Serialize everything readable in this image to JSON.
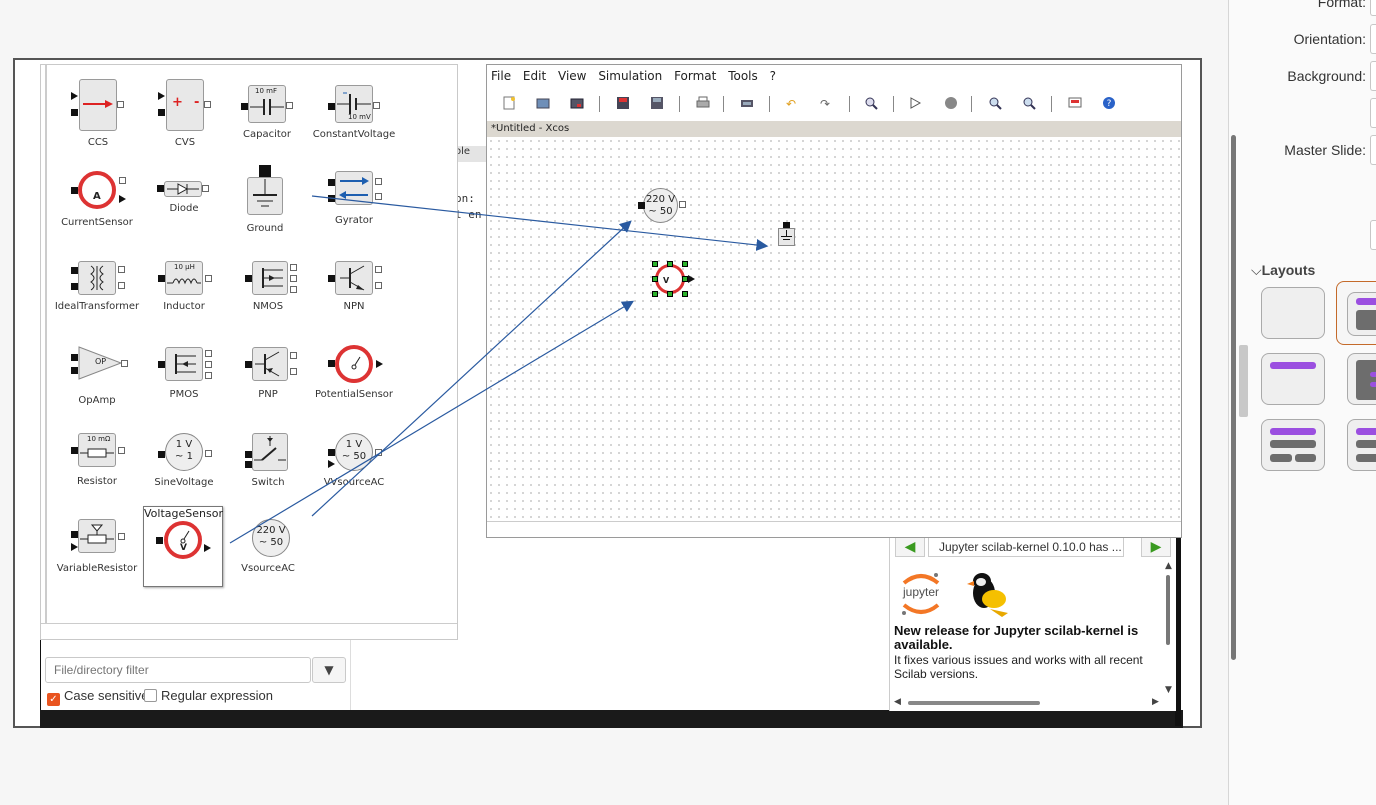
{
  "props_panel": {
    "format_label": "Format:",
    "orientation_label": "Orientation:",
    "background_label": "Background:",
    "master_slide_label": "Master Slide:",
    "layouts_title": "Layouts",
    "layouts_chevron": "⌵",
    "accent_color": "#9b4fe0"
  },
  "xcos": {
    "menu": {
      "file": "File",
      "edit": "Edit",
      "view": "View",
      "simulation": "Simulation",
      "format": "Format",
      "tools": "Tools",
      "help": "?"
    },
    "toolbar_icons": [
      "new-icon",
      "open-icon",
      "open-file-icon",
      "save-icon",
      "save-as-icon",
      "print-icon",
      "export-icon",
      "undo-icon",
      "redo-icon",
      "fit-icon",
      "start-icon",
      "stop-icon",
      "zoom-in-icon",
      "zoom-out-icon",
      "xcos-demos-icon",
      "help-icon"
    ],
    "tab_title": "*Untitled - Xcos",
    "canvas_blocks": {
      "vsource_line1": "220 V",
      "vsource_line2": "~ 50"
    }
  },
  "console_peek": {
    "line1": "ole",
    "line2": "on:",
    "line3": "l en"
  },
  "palette": {
    "blocks": [
      {
        "name": "CCS"
      },
      {
        "name": "CVS"
      },
      {
        "name": "Capacitor",
        "badge": "10 mF"
      },
      {
        "name": "ConstantVoltage",
        "badge": "10 mV"
      },
      {
        "name": "CurrentSensor"
      },
      {
        "name": "Diode"
      },
      {
        "name": "Ground"
      },
      {
        "name": "Gyrator"
      },
      {
        "name": "IdealTransformer"
      },
      {
        "name": "Inductor",
        "badge": "10 μH"
      },
      {
        "name": "NMOS"
      },
      {
        "name": "NPN"
      },
      {
        "name": "OpAmp",
        "badge": "OP"
      },
      {
        "name": "PMOS"
      },
      {
        "name": "PNP"
      },
      {
        "name": "PotentialSensor"
      },
      {
        "name": "Resistor",
        "badge": "10 mΩ"
      },
      {
        "name": "SineVoltage",
        "line1": "1 V",
        "line2": "~ 1"
      },
      {
        "name": "Switch"
      },
      {
        "name": "VVsourceAC",
        "line1": "1 V",
        "line2": "~ 50"
      },
      {
        "name": "VariableResistor"
      },
      {
        "name": "VoltageSensor"
      },
      {
        "name": "VsourceAC",
        "line1": "220 V",
        "line2": "~ 50"
      }
    ],
    "ccs_symbols": {
      "plus": "+",
      "minus": "-"
    },
    "current_sensor_letter": "A",
    "voltage_sensor_letter": "V"
  },
  "file_browser": {
    "filter_placeholder": "File/directory filter",
    "case_sensitive_label": "Case sensitive",
    "case_sensitive_checked": true,
    "regex_label": "Regular expression",
    "regex_checked": false
  },
  "news": {
    "title": "Jupyter scilab-kernel 0.10.0 has ...",
    "headline": "New release for Jupyter scilab-kernel is available.",
    "body": "It fixes various issues and works with all recent Scilab versions.",
    "jupyter_logo_text": "jupyter",
    "prev_symbol": "◀",
    "next_symbol": "▶"
  }
}
